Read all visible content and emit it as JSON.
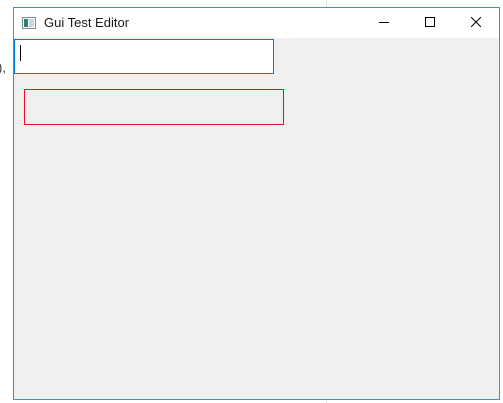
{
  "background": {
    "partial_text": "),"
  },
  "window": {
    "title": "Gui Test Editor",
    "icons": {
      "app": "app-window-icon",
      "minimize": "minimize-icon",
      "maximize": "maximize-icon",
      "close": "close-icon"
    },
    "border_color": "#3f8ed8",
    "client_bg": "#f0f0f0"
  },
  "editor": {
    "input_value": "",
    "input_border_color": "#0078d7",
    "red_box_border_color": "#e81123"
  }
}
